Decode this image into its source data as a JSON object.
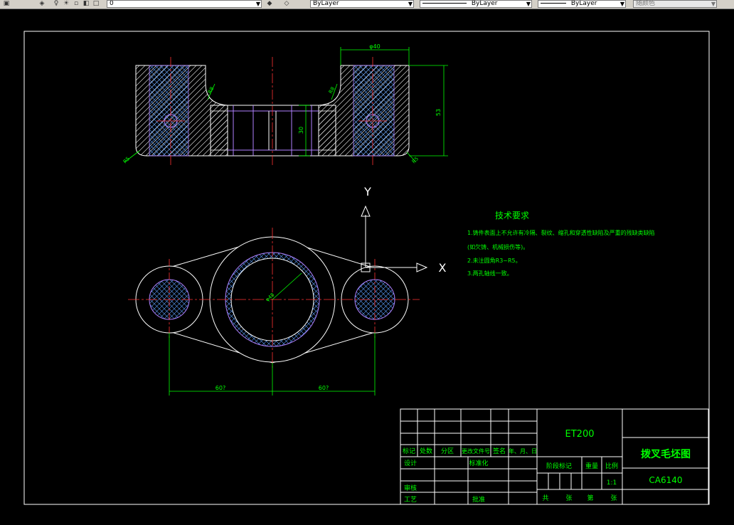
{
  "toolbar": {
    "layer_value": "0",
    "color_value": "ByLayer",
    "linetype_value": "ByLayer",
    "lineweight_value": "ByLayer",
    "plotstyle_value": "随颜色",
    "icons": [
      "layer-manager-icon",
      "layer-state-icon",
      "lightbulb-icon",
      "sun-icon",
      "lock-icon",
      "color-square-icon",
      "make-layer-current-icon",
      "layer-previous-icon"
    ]
  },
  "drawing": {
    "dim_top_width": "φ40",
    "dim_height_total": "53",
    "dim_inner_height": "30",
    "dim_r5_left": "R5",
    "dim_r5_right": "R5",
    "dim_r8_left": "R8",
    "dim_r8_right": "R8",
    "dim_center_dia": "φ48",
    "dim_left_span": "60?",
    "dim_right_span": "60?",
    "ucs_y_label": "Y",
    "ucs_x_label": "X"
  },
  "tech_requirements": {
    "title": "技术要求",
    "line1": "1.铸件表面上不允许有冷隔、裂纹、缩孔和穿透性缺陷及严重的残缺类缺陷",
    "line2": "(如欠铸、机械损伤等)。",
    "line3": "2.未注圆角R3~R5。",
    "line4": "3.两孔轴线一致。"
  },
  "title_block": {
    "code": "ET200",
    "name": "拨叉毛坯图",
    "model": "CA6140",
    "h_mark": "标记",
    "h_count": "处数",
    "h_zone": "分区",
    "h_docno": "更改文件号",
    "h_sign": "签名",
    "h_date": "年、月、日",
    "design": "设计",
    "standard": "标准化",
    "stage": "阶段标记",
    "weight": "重量",
    "scale_label": "比例",
    "scale_value": "1:1",
    "check": "审核",
    "process": "工艺",
    "approve": "批准",
    "total": "共",
    "sheets": "张",
    "page": "第",
    "page_sheets": "张"
  }
}
